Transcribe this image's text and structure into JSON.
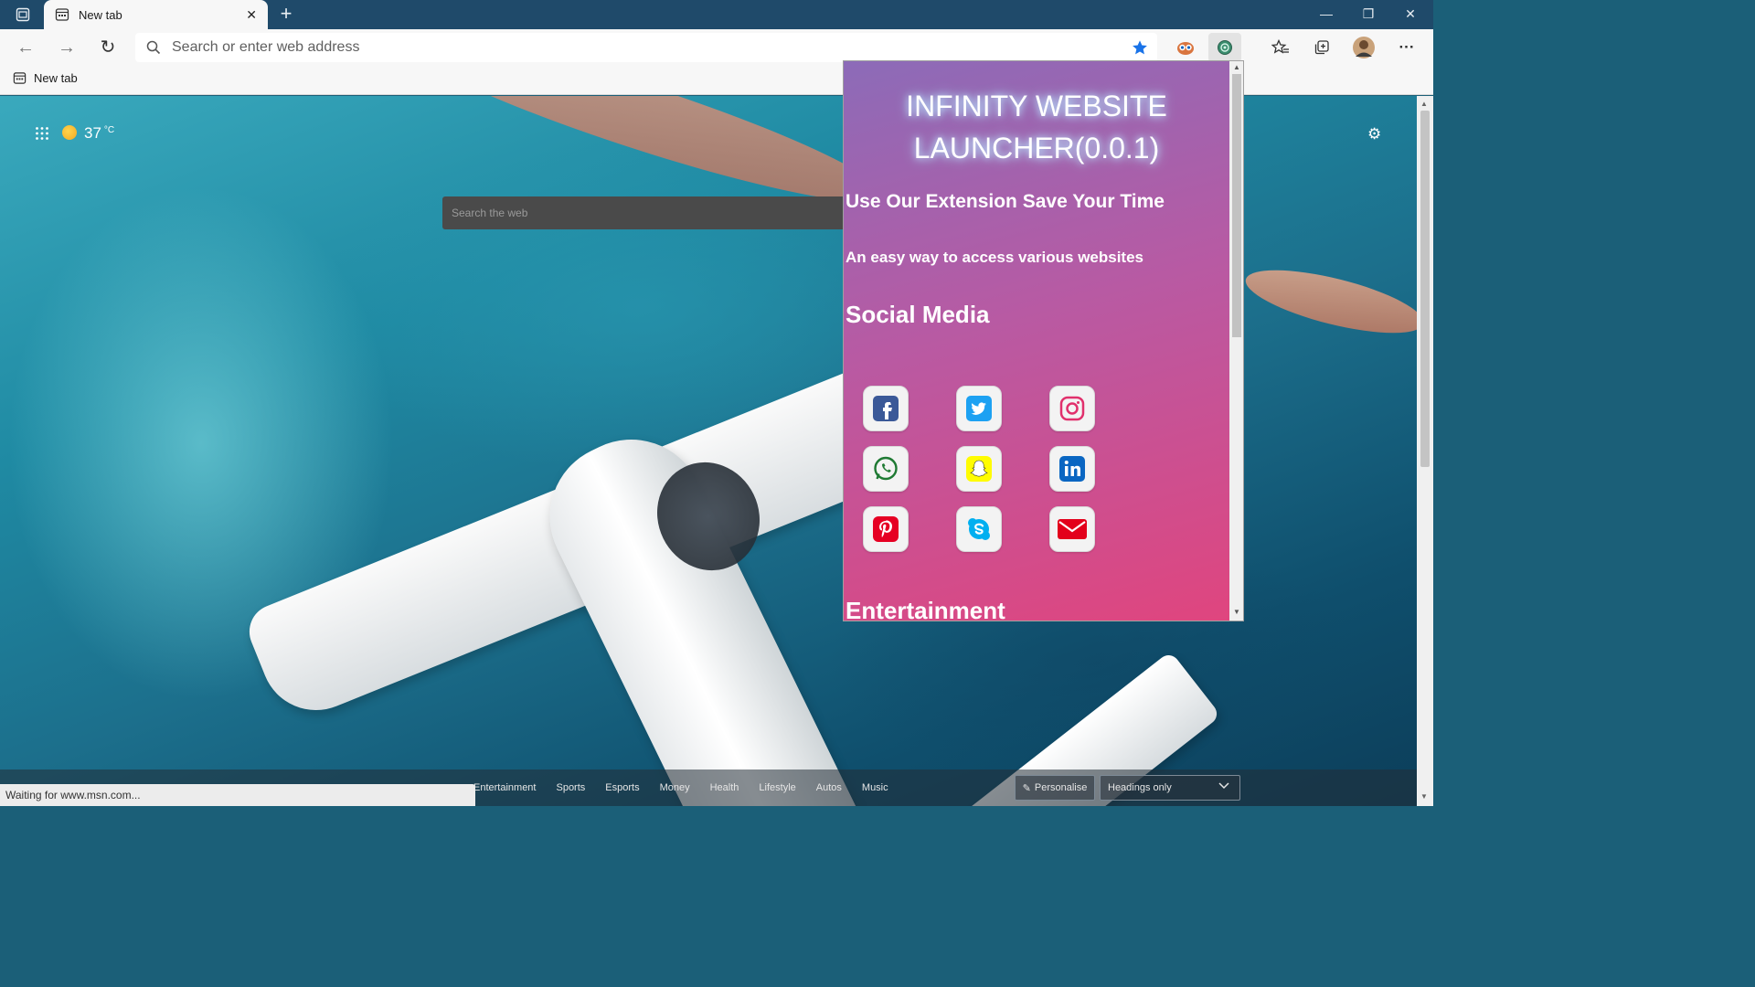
{
  "browser": {
    "tab_title": "New tab",
    "address_placeholder": "Search or enter web address",
    "favorites": [
      {
        "label": "New tab"
      }
    ],
    "status_text": "Waiting for www.msn.com..."
  },
  "newtab": {
    "weather_temp": "37",
    "weather_unit": "°C",
    "search_placeholder": "Search the web",
    "categories": [
      "Entertainment",
      "Sports",
      "Esports",
      "Money",
      "Health",
      "Lifestyle",
      "Autos",
      "Music"
    ],
    "personalise_label": "Personalise",
    "headings_select": "Headings only"
  },
  "extension": {
    "title_line1": "INFINITY WEBSITE",
    "title_line2": "LAUNCHER(0.0.1)",
    "tagline": "Use Our Extension Save Your Time",
    "subtitle": "An easy way to access various websites",
    "section_social": "Social Media",
    "section_entertainment": "Entertainment",
    "social_icons": [
      "facebook-icon",
      "twitter-icon",
      "instagram-icon",
      "whatsapp-icon",
      "snapchat-icon",
      "linkedin-icon",
      "pinterest-icon",
      "skype-icon",
      "mail-icon"
    ]
  },
  "colors": {
    "popup_gradient_start": "#8c6bb8",
    "popup_gradient_end": "#e0457e",
    "facebook": "#3b5998",
    "twitter": "#1da1f2",
    "instagram": "#e1306c",
    "whatsapp": "#25d366",
    "snapchat": "#fffc00",
    "linkedin": "#0a66c2",
    "pinterest": "#e60023",
    "skype": "#00aff0",
    "mail": "#e3001b"
  }
}
